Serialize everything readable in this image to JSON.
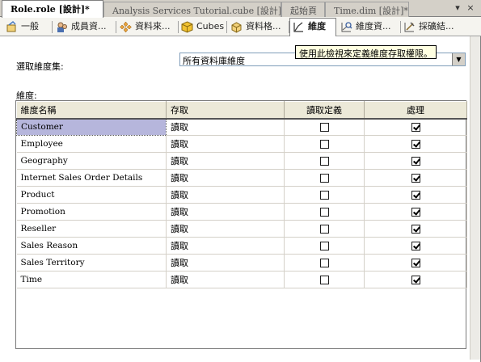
{
  "doc_tabs": [
    {
      "label": "Role.role [設計]*",
      "active": true
    },
    {
      "label": "Analysis Services Tutorial.cube [設計]*",
      "active": false
    },
    {
      "label": "起始頁",
      "active": false
    },
    {
      "label": "Time.dim [設計]*",
      "active": false
    }
  ],
  "window_controls": {
    "dropdown": "▾",
    "close": "×"
  },
  "designer_tabs": [
    {
      "label": "一般",
      "icon": "general-icon"
    },
    {
      "label": "成員資...",
      "icon": "membership-icon"
    },
    {
      "label": "資料來...",
      "icon": "data-source-icon"
    },
    {
      "label": "Cubes",
      "icon": "cube-icon",
      "active": true
    },
    {
      "label": "資料格...",
      "icon": "cell-data-icon"
    },
    {
      "label": "維度",
      "icon": "dimensions-icon",
      "active": true
    },
    {
      "label": "維度資...",
      "icon": "dimension-data-icon"
    },
    {
      "label": "採礦結...",
      "icon": "mining-structures-icon"
    }
  ],
  "dimension_set": {
    "label": "選取維度集:",
    "value": "所有資料庫維度",
    "tooltip": "使用此檢視來定義維度存取權限。"
  },
  "dimensions_label": "維度:",
  "grid": {
    "headers": [
      "維度名稱",
      "存取",
      "讀取定義",
      "處理"
    ],
    "rows": [
      {
        "name": "Customer",
        "access": "讀取",
        "read_definition": false,
        "process": true,
        "selected": true
      },
      {
        "name": "Employee",
        "access": "讀取",
        "read_definition": false,
        "process": true
      },
      {
        "name": "Geography",
        "access": "讀取",
        "read_definition": false,
        "process": true
      },
      {
        "name": "Internet Sales Order Details",
        "access": "讀取",
        "read_definition": false,
        "process": true
      },
      {
        "name": "Product",
        "access": "讀取",
        "read_definition": false,
        "process": true
      },
      {
        "name": "Promotion",
        "access": "讀取",
        "read_definition": false,
        "process": true
      },
      {
        "name": "Reseller",
        "access": "讀取",
        "read_definition": false,
        "process": true
      },
      {
        "name": "Sales Reason",
        "access": "讀取",
        "read_definition": false,
        "process": true
      },
      {
        "name": "Sales Territory",
        "access": "讀取",
        "read_definition": false,
        "process": true
      },
      {
        "name": "Time",
        "access": "讀取",
        "read_definition": false,
        "process": true
      }
    ]
  }
}
